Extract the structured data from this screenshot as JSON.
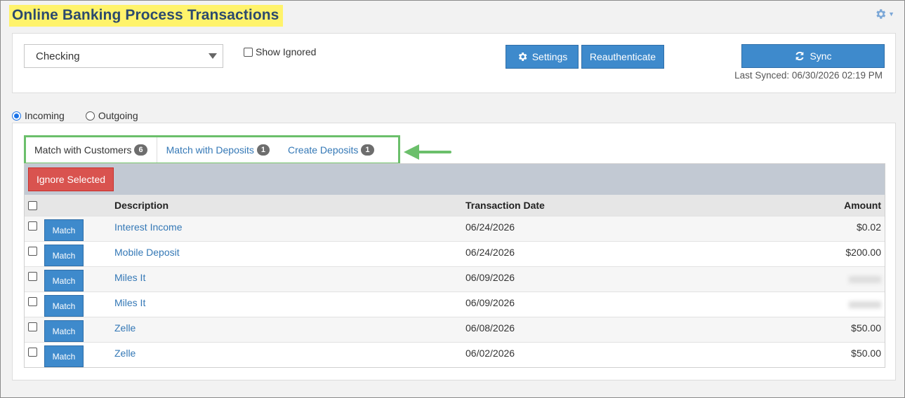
{
  "page": {
    "title": "Online Banking Process Transactions"
  },
  "icons": {
    "settings_gear": "gear-icon",
    "sync": "sync-icon",
    "dropdown": "chevron-down-icon"
  },
  "colors": {
    "primary": "#3e8acc",
    "danger": "#d9534f",
    "highlight": "#fff36b",
    "tab_outline": "#6bbf6b"
  },
  "filters": {
    "account": {
      "selected": "Checking"
    },
    "show_ignored": {
      "label": "Show Ignored",
      "checked": false
    }
  },
  "actions": {
    "settings_label": "Settings",
    "reauth_label": "Reauthenticate",
    "sync_label": "Sync",
    "last_synced": "Last Synced: 06/30/2026 02:19 PM"
  },
  "direction": {
    "incoming_label": "Incoming",
    "outgoing_label": "Outgoing",
    "selected": "Incoming"
  },
  "tabs": [
    {
      "label": "Match with Customers",
      "count": "6",
      "active": true
    },
    {
      "label": "Match with Deposits",
      "count": "1",
      "active": false
    },
    {
      "label": "Create Deposits",
      "count": "1",
      "active": false
    }
  ],
  "table": {
    "ignore_label": "Ignore Selected",
    "match_label": "Match",
    "columns": {
      "description": "Description",
      "date": "Transaction Date",
      "amount": "Amount"
    },
    "rows": [
      {
        "description": "Interest Income",
        "date": "06/24/2026",
        "amount": "$0.02"
      },
      {
        "description": "Mobile Deposit",
        "date": "06/24/2026",
        "amount": "$200.00"
      },
      {
        "description": "Miles It",
        "date": "06/09/2026",
        "amount": ""
      },
      {
        "description": "Miles It",
        "date": "06/09/2026",
        "amount": ""
      },
      {
        "description": "Zelle",
        "date": "06/08/2026",
        "amount": "$50.00"
      },
      {
        "description": "Zelle",
        "date": "06/02/2026",
        "amount": "$50.00"
      }
    ]
  }
}
